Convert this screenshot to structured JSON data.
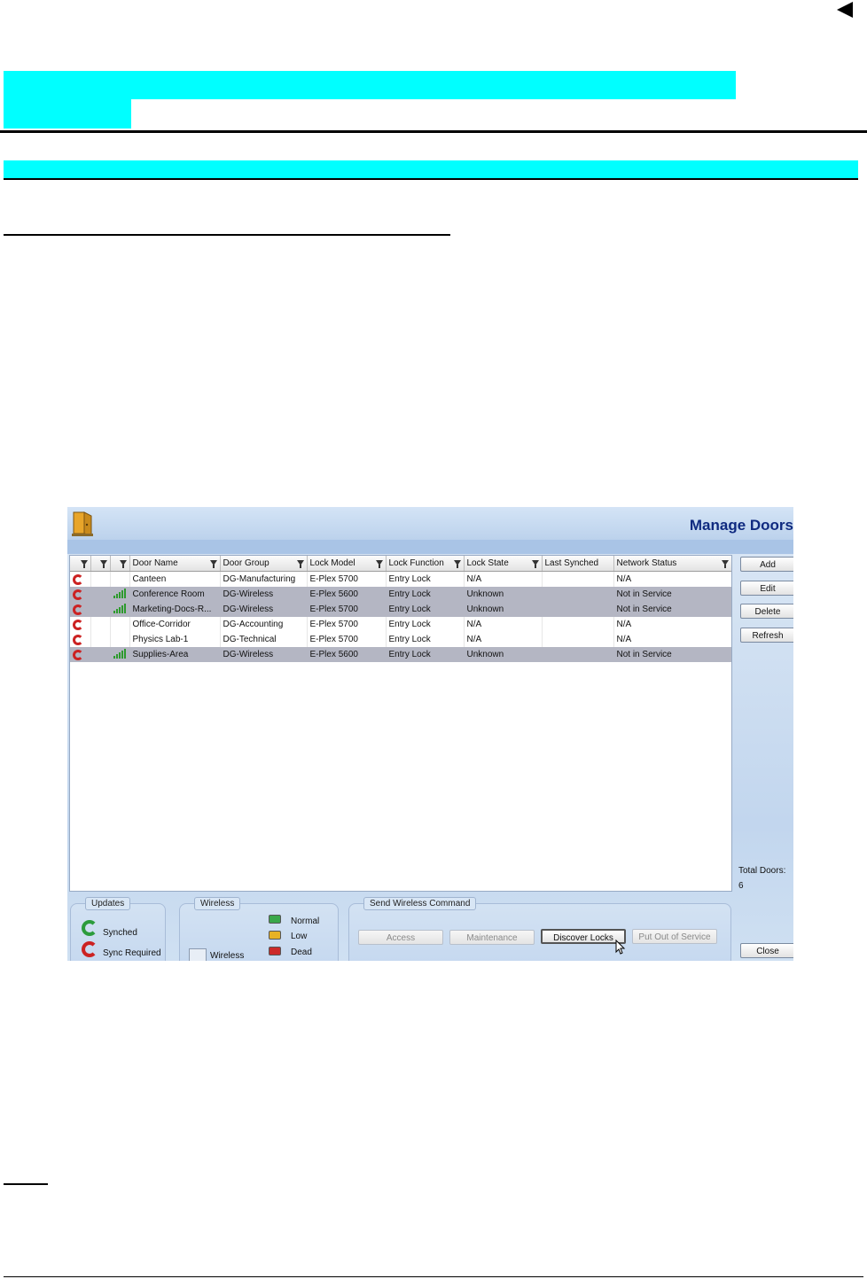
{
  "app": {
    "title": "Manage Doors",
    "colors": {
      "highlight": "#00ffff",
      "title_text": "#0f2a80",
      "selected_row": "#b4b6c3"
    }
  },
  "grid": {
    "columns": [
      "",
      "",
      "",
      "Door Name",
      "Door Group",
      "Lock Model",
      "Lock Function",
      "Lock State",
      "Last Synched",
      "Network Status"
    ],
    "rows": [
      {
        "sync": "sync-required-icon",
        "wireless": false,
        "cells": [
          "Canteen",
          "DG-Manufacturing",
          "E-Plex 5700",
          "Entry Lock",
          "N/A",
          "",
          "N/A"
        ],
        "highlighted": false
      },
      {
        "sync": "sync-required-icon",
        "wireless": true,
        "cells": [
          "Conference Room",
          "DG-Wireless",
          "E-Plex 5600",
          "Entry Lock",
          "Unknown",
          "",
          "Not in Service"
        ],
        "highlighted": true
      },
      {
        "sync": "sync-required-icon",
        "wireless": true,
        "cells": [
          "Marketing-Docs-R...",
          "DG-Wireless",
          "E-Plex 5700",
          "Entry Lock",
          "Unknown",
          "",
          "Not in Service"
        ],
        "highlighted": true
      },
      {
        "sync": "sync-required-icon",
        "wireless": false,
        "cells": [
          "Office-Corridor",
          "DG-Accounting",
          "E-Plex 5700",
          "Entry Lock",
          "N/A",
          "",
          "N/A"
        ],
        "highlighted": false
      },
      {
        "sync": "sync-required-icon",
        "wireless": false,
        "cells": [
          "Physics Lab-1",
          "DG-Technical",
          "E-Plex 5700",
          "Entry Lock",
          "N/A",
          "",
          "N/A"
        ],
        "highlighted": false
      },
      {
        "sync": "sync-required-icon",
        "wireless": true,
        "cells": [
          "Supplies-Area",
          "DG-Wireless",
          "E-Plex 5600",
          "Entry Lock",
          "Unknown",
          "",
          "Not in Service"
        ],
        "highlighted": true
      }
    ]
  },
  "buttons": {
    "add": "Add",
    "edit": "Edit",
    "delete": "Delete",
    "refresh": "Refresh",
    "close": "Close"
  },
  "totals": {
    "label": "Total Doors:",
    "value": "6"
  },
  "updates": {
    "title": "Updates",
    "synched": "Synched",
    "sync_required": "Sync Required"
  },
  "wireless_legend": {
    "title": "Wireless",
    "wireless": "Wireless",
    "normal": "Normal",
    "low": "Low",
    "dead": "Dead"
  },
  "send_command": {
    "title": "Send Wireless Command",
    "access": "Access",
    "maintenance": "Maintenance",
    "discover": "Discover Locks",
    "out_of_service": "Put Out of Service"
  }
}
